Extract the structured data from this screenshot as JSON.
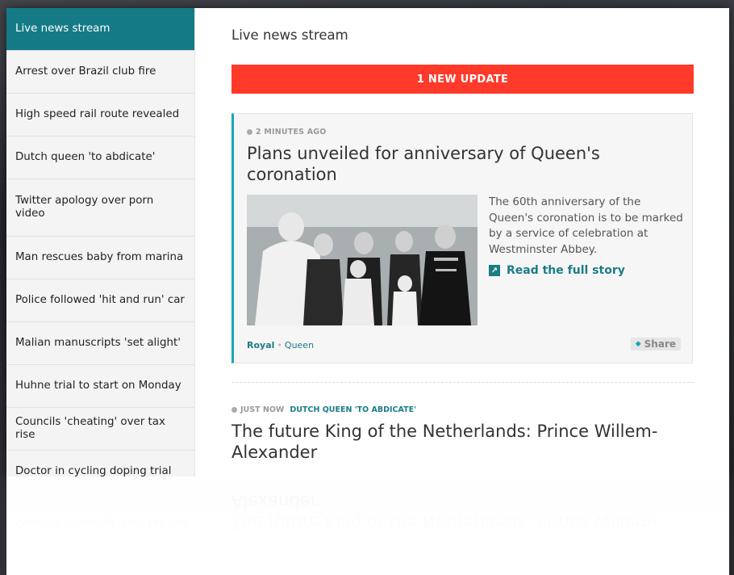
{
  "sidebar": {
    "items": [
      {
        "label": "Live news stream",
        "active": true
      },
      {
        "label": "Arrest over Brazil club fire"
      },
      {
        "label": "High speed rail route revealed"
      },
      {
        "label": "Dutch queen 'to abdicate'"
      },
      {
        "label": "Twitter apology over porn video"
      },
      {
        "label": "Man rescues baby from marina"
      },
      {
        "label": "Police followed 'hit and run' car"
      },
      {
        "label": "Malian manuscripts 'set alight'"
      },
      {
        "label": "Huhne trial to start on Monday"
      },
      {
        "label": "Councils 'cheating' over tax rise"
      },
      {
        "label": "Doctor in cycling doping trial"
      }
    ]
  },
  "main": {
    "title": "Live news stream",
    "update_bar": "1 NEW UPDATE",
    "card": {
      "time": "2 MINUTES AGO",
      "headline": "Plans unveiled for anniversary of Queen's coronation",
      "summary": "The 60th anniversary of the Queen's coronation is to be marked by a service of celebration at Westminster Abbey.",
      "read_more": "Read the full story",
      "tag_primary": "Royal",
      "tag_secondary": "Queen",
      "share": "Share"
    },
    "item2": {
      "time": "JUST NOW",
      "link": "DUTCH QUEEN 'TO ABDICATE'",
      "headline": "The future King of the Netherlands: Prince Willem-Alexander"
    }
  },
  "colors": {
    "accent": "#147b86",
    "alert": "#ff3a2a",
    "card_border": "#1aa6b5"
  },
  "icons": {
    "clock": "clock-icon",
    "arrow": "external-arrow-icon",
    "share": "share-icon"
  }
}
